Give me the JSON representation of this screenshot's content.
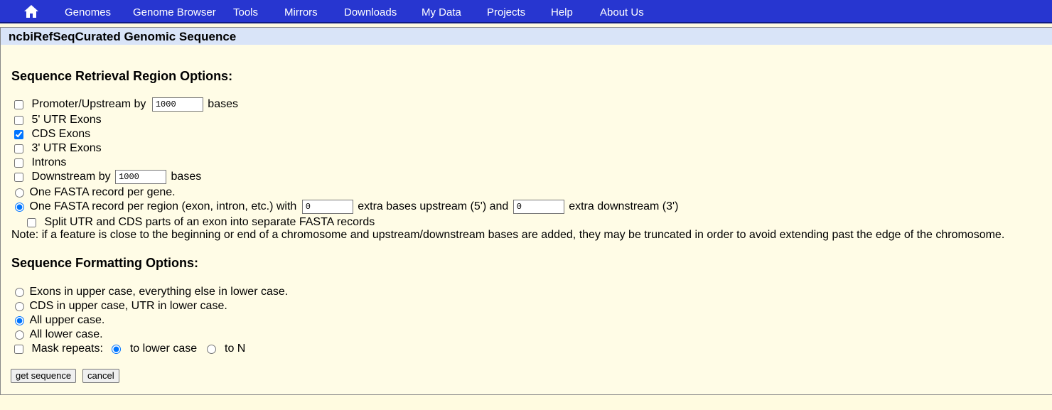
{
  "nav": {
    "items": [
      "Genomes",
      "Genome Browser",
      "Tools",
      "Mirrors",
      "Downloads",
      "My Data",
      "Projects",
      "Help",
      "About Us"
    ]
  },
  "title": "ncbiRefSeqCurated Genomic Sequence",
  "region_options": {
    "heading": "Sequence Retrieval Region Options:",
    "promoter": {
      "label": "Promoter/Upstream by",
      "value": "1000",
      "suffix": "bases",
      "checked": false
    },
    "utr5": {
      "label": "5' UTR Exons",
      "checked": false
    },
    "cds": {
      "label": "CDS Exons",
      "checked": true
    },
    "utr3": {
      "label": "3' UTR Exons",
      "checked": false
    },
    "introns": {
      "label": "Introns",
      "checked": false
    },
    "downstream": {
      "label": "Downstream by",
      "value": "1000",
      "suffix": "bases",
      "checked": false
    },
    "one_per_gene": {
      "label": "One FASTA record per gene.",
      "selected": false
    },
    "one_per_region": {
      "label": "One FASTA record per region (exon, intron, etc.) with",
      "up_value": "0",
      "mid": "extra bases upstream (5') and",
      "down_value": "0",
      "end": "extra downstream (3')",
      "selected": true
    },
    "split_utr": {
      "label": "Split UTR and CDS parts of an exon into separate FASTA records",
      "checked": false
    },
    "note": "Note: if a feature is close to the beginning or end of a chromosome and upstream/downstream bases are added, they may be truncated in order to avoid extending past the edge of the chromosome."
  },
  "format_options": {
    "heading": "Sequence Formatting Options:",
    "exons_upper": {
      "label": "Exons in upper case, everything else in lower case.",
      "selected": false
    },
    "cds_upper": {
      "label": "CDS in upper case, UTR in lower case.",
      "selected": false
    },
    "all_upper": {
      "label": "All upper case.",
      "selected": true
    },
    "all_lower": {
      "label": "All lower case.",
      "selected": false
    },
    "mask": {
      "label": "Mask repeats:",
      "checked": false,
      "lower_label": "to lower case",
      "lower_selected": true,
      "n_label": "to N",
      "n_selected": false
    }
  },
  "buttons": {
    "get_sequence": "get sequence",
    "cancel": "cancel"
  },
  "colors": {
    "nav_bg": "#2736D0",
    "title_bg": "#D9E4F8",
    "page_bg": "#FFFCE6"
  }
}
